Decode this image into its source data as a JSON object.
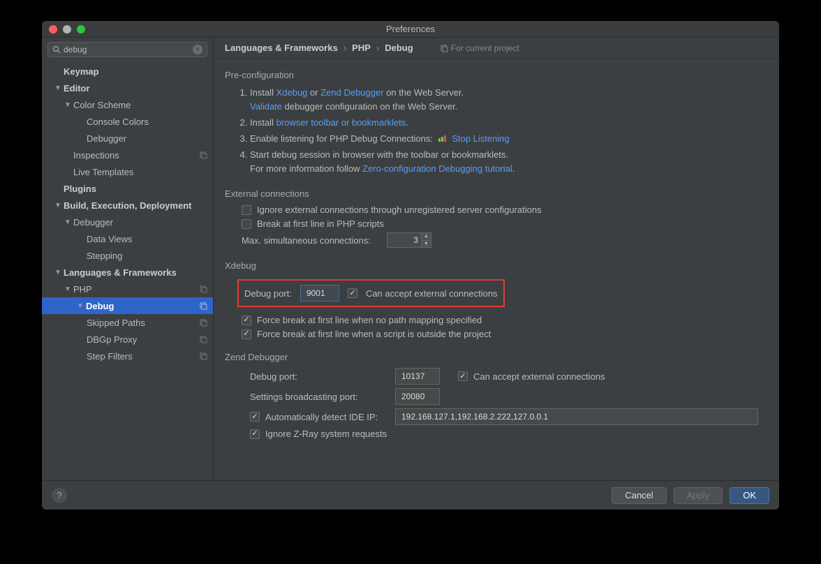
{
  "window_title": "Preferences",
  "search_value": "debug",
  "tree": {
    "keymap": "Keymap",
    "editor": "Editor",
    "color_scheme": "Color Scheme",
    "console_colors": "Console Colors",
    "debugger_cs": "Debugger",
    "inspections": "Inspections",
    "live_templates": "Live Templates",
    "plugins": "Plugins",
    "bed": "Build, Execution, Deployment",
    "debugger": "Debugger",
    "data_views": "Data Views",
    "stepping": "Stepping",
    "langfw": "Languages & Frameworks",
    "php": "PHP",
    "debug": "Debug",
    "skipped_paths": "Skipped Paths",
    "dbgp_proxy": "DBGp Proxy",
    "step_filters": "Step Filters"
  },
  "breadcrumb": {
    "a": "Languages & Frameworks",
    "b": "PHP",
    "c": "Debug"
  },
  "project_hint": "For current project",
  "preconf": {
    "title": "Pre-configuration",
    "l1a": "Install ",
    "l1b": "Xdebug",
    "l1c": " or ",
    "l1d": "Zend Debugger",
    "l1e": " on the Web Server.",
    "l1f": "Validate",
    "l1g": " debugger configuration on the Web Server.",
    "l2a": "Install ",
    "l2b": "browser toolbar or bookmarklets",
    "l2c": ".",
    "l3a": "Enable listening for PHP Debug Connections: ",
    "l3b": "Stop Listening",
    "l4a": "Start debug session in browser with the toolbar or bookmarklets.",
    "l4b": "For more information follow ",
    "l4c": "Zero-configuration Debugging tutorial",
    "l4d": "."
  },
  "ext": {
    "title": "External connections",
    "ignore": "Ignore external connections through unregistered server configurations",
    "break_first": "Break at first line in PHP scripts",
    "max_label": "Max. simultaneous connections:",
    "max_value": "3"
  },
  "xdebug": {
    "title": "Xdebug",
    "port_label": "Debug port:",
    "port_value": "9001",
    "accept": "Can accept external connections",
    "force1": "Force break at first line when no path mapping specified",
    "force2": "Force break at first line when a script is outside the project"
  },
  "zend": {
    "title": "Zend Debugger",
    "port_label": "Debug port:",
    "port_value": "10137",
    "accept": "Can accept external connections",
    "bcast_label": "Settings broadcasting port:",
    "bcast_value": "20080",
    "auto_ip": "Automatically detect IDE IP:",
    "ip_value": "192.168.127.1,192.168.2.222,127.0.0.1",
    "zray": "Ignore Z-Ray system requests"
  },
  "footer": {
    "cancel": "Cancel",
    "apply": "Apply",
    "ok": "OK"
  }
}
